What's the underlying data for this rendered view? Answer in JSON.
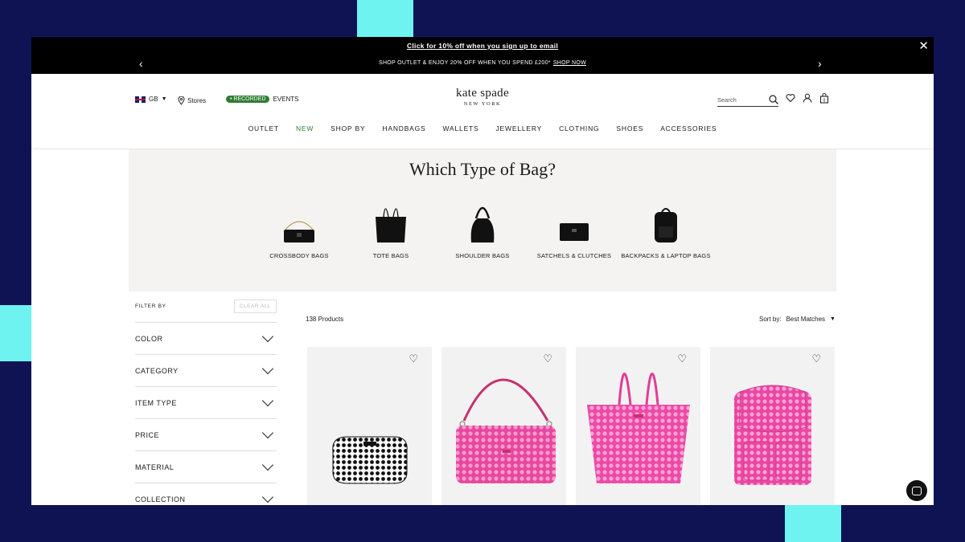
{
  "promo": {
    "line1": "Click for 10% off when you sign up to email",
    "line2": "SHOP OUTLET & ENJOY 20% OFF WHEN YOU SPEND £200*",
    "line2_link": "SHOP NOW"
  },
  "header": {
    "locale": "GB",
    "stores": "Stores",
    "badge": "RECORDED",
    "events": "EVENTS",
    "logo_main": "kate spade",
    "logo_sub": "NEW YORK",
    "search_placeholder": "Search",
    "bag_count": "0"
  },
  "nav": [
    "OUTLET",
    "NEW",
    "SHOP BY",
    "HANDBAGS",
    "WALLETS",
    "JEWELLERY",
    "CLOTHING",
    "SHOES",
    "ACCESSORIES"
  ],
  "bag_types": {
    "title": "Which Type of Bag?",
    "items": [
      "CROSSBODY BAGS",
      "TOTE BAGS",
      "SHOULDER BAGS",
      "SATCHELS & CLUTCHES",
      "BACKPACKS & LAPTOP BAGS"
    ]
  },
  "filters": {
    "label": "FILTER BY",
    "clear": "CLEAR ALL",
    "items": [
      "COLOR",
      "CATEGORY",
      "ITEM TYPE",
      "PRICE",
      "MATERIAL",
      "COLLECTION"
    ]
  },
  "results": {
    "count": "138 Products",
    "sort_label": "Sort by:",
    "sort_value": "Best Matches"
  },
  "colors": {
    "accent_green": "#2e7d32",
    "pink": "#e8479f",
    "background": "#0f1354",
    "decor": "#6ef3f0"
  }
}
